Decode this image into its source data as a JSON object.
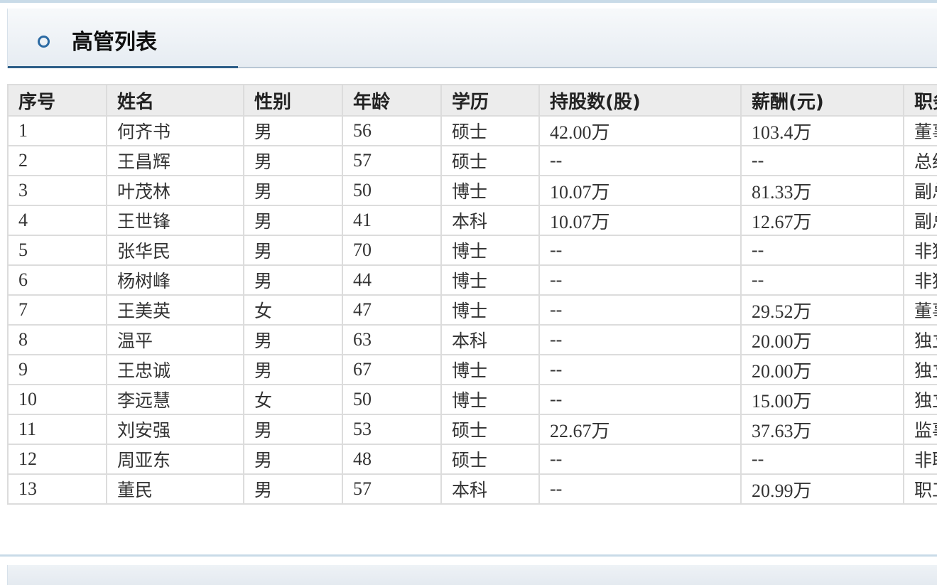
{
  "panel": {
    "title": "高管列表",
    "icon": "ring-bullet-icon"
  },
  "colors": {
    "accent": "#2c5d88",
    "header_bg": "#ececec",
    "border": "#dcdcdc",
    "panel_bg": "#e6ecf2"
  },
  "table": {
    "columns": [
      "序号",
      "姓名",
      "性别",
      "年龄",
      "学历",
      "持股数(股)",
      "薪酬(元)",
      "职务"
    ],
    "rows": [
      [
        "1",
        "何齐书",
        "男",
        "56",
        "硕士",
        "42.00万",
        "103.4万",
        "董事"
      ],
      [
        "2",
        "王昌辉",
        "男",
        "57",
        "硕士",
        "--",
        "--",
        "总经理"
      ],
      [
        "3",
        "叶茂林",
        "男",
        "50",
        "博士",
        "10.07万",
        "81.33万",
        "副总"
      ],
      [
        "4",
        "王世锋",
        "男",
        "41",
        "本科",
        "10.07万",
        "12.67万",
        "副总"
      ],
      [
        "5",
        "张华民",
        "男",
        "70",
        "博士",
        "--",
        "--",
        "非独"
      ],
      [
        "6",
        "杨树峰",
        "男",
        "44",
        "博士",
        "--",
        "--",
        "非独"
      ],
      [
        "7",
        "王美英",
        "女",
        "47",
        "博士",
        "--",
        "29.52万",
        "董事"
      ],
      [
        "8",
        "温平",
        "男",
        "63",
        "本科",
        "--",
        "20.00万",
        "独立"
      ],
      [
        "9",
        "王忠诚",
        "男",
        "67",
        "博士",
        "--",
        "20.00万",
        "独立"
      ],
      [
        "10",
        "李远慧",
        "女",
        "50",
        "博士",
        "--",
        "15.00万",
        "独立"
      ],
      [
        "11",
        "刘安强",
        "男",
        "53",
        "硕士",
        "22.67万",
        "37.63万",
        "监事"
      ],
      [
        "12",
        "周亚东",
        "男",
        "48",
        "硕士",
        "--",
        "--",
        "非职"
      ],
      [
        "13",
        "董民",
        "男",
        "57",
        "本科",
        "--",
        "20.99万",
        "职工"
      ]
    ]
  }
}
